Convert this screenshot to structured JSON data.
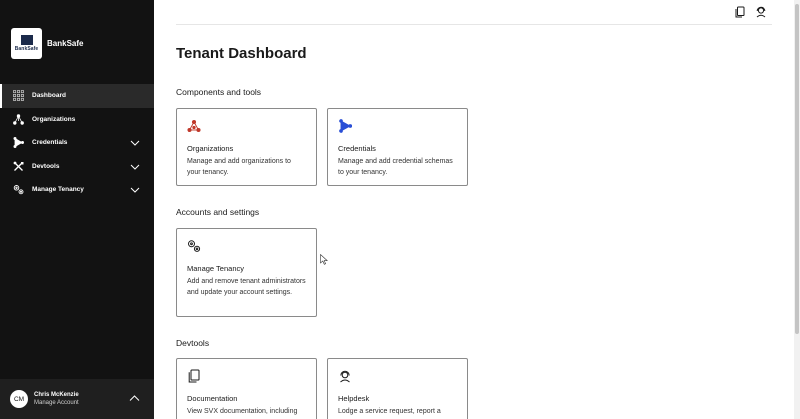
{
  "sidebar": {
    "brand_name": "BankSafe",
    "logo_text": "BankSafe",
    "items": [
      {
        "label": "Dashboard",
        "icon": "grid-icon",
        "active": true
      },
      {
        "label": "Organizations",
        "icon": "org-network-icon"
      },
      {
        "label": "Credentials",
        "icon": "credential-icon"
      },
      {
        "label": "Devtools",
        "icon": "tools-icon"
      },
      {
        "label": "Manage Tenancy",
        "icon": "gears-icon"
      }
    ],
    "user": {
      "initials": "CM",
      "name": "Chris McKenzie",
      "sub": "Manage Account"
    }
  },
  "header": {
    "icons": [
      "document-icon",
      "support-agent-icon"
    ]
  },
  "main": {
    "title": "Tenant Dashboard",
    "sections": [
      {
        "title": "Components and tools",
        "cards": [
          {
            "title": "Organizations",
            "desc": "Manage and add organizations to your tenancy.",
            "icon": "org-network-icon",
            "color": "#c0392b"
          },
          {
            "title": "Credentials",
            "desc": "Manage and add credential schemas to your tenancy.",
            "icon": "credential-icon",
            "color": "#2a4fd6"
          }
        ]
      },
      {
        "title": "Accounts and settings",
        "cards": [
          {
            "title": "Manage Tenancy",
            "desc": "Add and remove tenant administrators and update your account settings.",
            "icon": "gears-icon"
          }
        ]
      },
      {
        "title": "Devtools",
        "cards": [
          {
            "title": "Documentation",
            "desc": "View SVX documentation, including",
            "icon": "document-icon"
          },
          {
            "title": "Helpdesk",
            "desc": "Lodge a service request, report a",
            "icon": "support-agent-icon"
          }
        ]
      }
    ]
  }
}
